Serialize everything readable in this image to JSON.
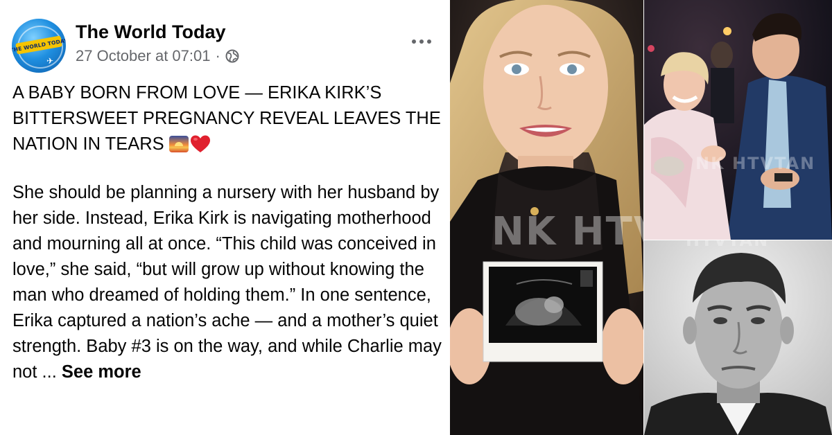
{
  "post": {
    "page_name": "The World Today",
    "avatar_text": "THE WORLD TODAY",
    "timestamp": "27 October at 07:01",
    "separator": "·",
    "headline": "A BABY BORN FROM LOVE — ERIKA KIRK’S BITTERSWEET PREGNANCY REVEAL LEAVES THE NATION IN TEARS",
    "body": "She should be planning a nursery with her husband by her side. Instead, Erika Kirk is navigating motherhood and mourning all at once. “This child was conceived in love,” she said, “but will grow up without knowing the man who dreamed of holding them.” In one sentence, Erika captured a nation’s ache — and a mother’s quiet strength. Baby #3 is on the way, and while Charlie may not ...",
    "see_more": "See more",
    "icons": {
      "globe": "globe-icon",
      "more": "more-options-icon",
      "sunset": "sunset-emoji-icon",
      "heart": "red-heart-emoji-icon"
    }
  },
  "images": {
    "left_watermark": "NK HTVTAN",
    "top_right_watermark": "NK HTVTAN",
    "bottom_right_watermark": "HTVTAN"
  },
  "colors": {
    "text": "#050505",
    "secondary_text": "#65676b",
    "heart": "#e0202e"
  }
}
